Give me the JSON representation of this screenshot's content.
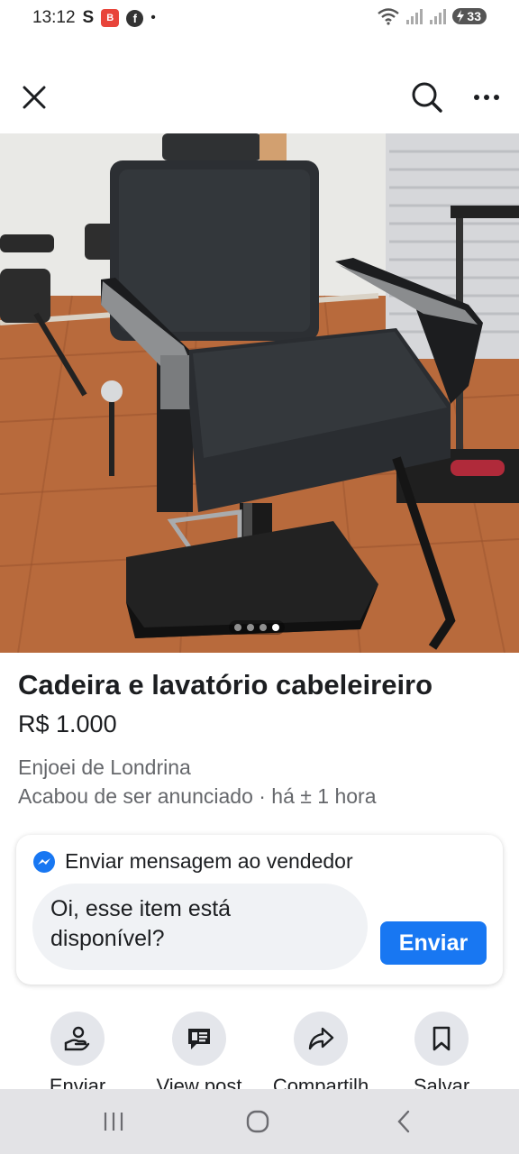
{
  "status_bar": {
    "time": "13:12",
    "app_s": "S",
    "app_badge": "B",
    "fb_badge": "f",
    "dot": "•",
    "battery": "33"
  },
  "listing": {
    "title": "Cadeira e lavatório cabeleireiro",
    "price": "R$ 1.000",
    "seller": "Enjoei de Londrina",
    "posted": "Acabou de ser anunciado  · há ± 1 hora",
    "photo_count": 4,
    "active_photo": 4
  },
  "message_card": {
    "header": "Enviar mensagem ao vendedor",
    "input_value": "Oi, esse item está disponível?",
    "send_label": "Enviar"
  },
  "actions": [
    {
      "label": "Enviar",
      "icon": "send-hand-icon"
    },
    {
      "label": "View post",
      "icon": "post-icon"
    },
    {
      "label": "Compartilh",
      "icon": "share-icon"
    },
    {
      "label": "Salvar",
      "icon": "bookmark-icon"
    }
  ],
  "colors": {
    "accent": "#1877f2",
    "secondary_text": "#65676b",
    "input_bg": "#f0f2f5"
  }
}
